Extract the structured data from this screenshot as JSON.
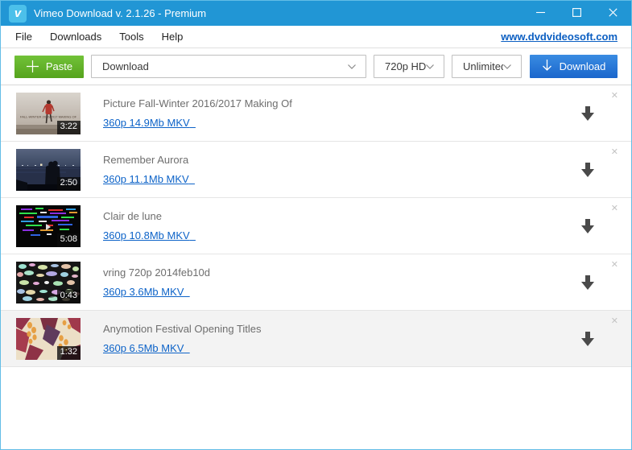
{
  "window": {
    "title": "Vimeo Download v. 2.1.26 - Premium"
  },
  "menu": {
    "items": [
      "File",
      "Downloads",
      "Tools",
      "Help"
    ],
    "website_link": "www.dvdvideosoft.com"
  },
  "toolbar": {
    "paste_label": "Paste",
    "url_dropdown_value": "Download",
    "quality_dropdown_value": "720p HD",
    "speed_dropdown_value": "Unlimited",
    "download_label": "Download"
  },
  "videos": [
    {
      "title": "Picture Fall-Winter 2016/2017 Making Of",
      "format_link": "360p 14.9Mb MKV",
      "duration": "3:22",
      "thumb_overlay_text": "FALL-WINTER 2016/2017 MAKING OF"
    },
    {
      "title": "Remember Aurora",
      "format_link": "360p 11.1Mb MKV",
      "duration": "2:50"
    },
    {
      "title": "Clair de lune",
      "format_link": "360p 10.8Mb MKV",
      "duration": "5:08"
    },
    {
      "title": "vring 720p 2014feb10d",
      "format_link": "360p 3.6Mb MKV",
      "duration": "0:43"
    },
    {
      "title": "Anymotion Festival Opening Titles",
      "format_link": "360p 6.5Mb MKV",
      "duration": "1:32",
      "highlighted": true
    }
  ],
  "colors": {
    "titlebar_blue": "#2196d5",
    "paste_green": "#60b02a",
    "download_blue": "#2277d7",
    "link_blue": "#0d63c8",
    "accent_border": "#63bde6"
  }
}
